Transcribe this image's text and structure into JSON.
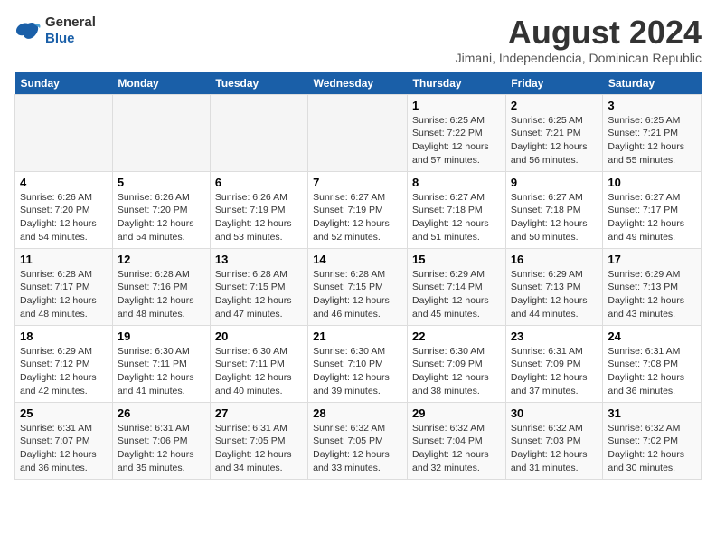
{
  "header": {
    "logo_general": "General",
    "logo_blue": "Blue",
    "month_year": "August 2024",
    "location": "Jimani, Independencia, Dominican Republic"
  },
  "calendar": {
    "weekdays": [
      "Sunday",
      "Monday",
      "Tuesday",
      "Wednesday",
      "Thursday",
      "Friday",
      "Saturday"
    ],
    "weeks": [
      [
        {
          "day": "",
          "info": ""
        },
        {
          "day": "",
          "info": ""
        },
        {
          "day": "",
          "info": ""
        },
        {
          "day": "",
          "info": ""
        },
        {
          "day": "1",
          "info": "Sunrise: 6:25 AM\nSunset: 7:22 PM\nDaylight: 12 hours and 57 minutes."
        },
        {
          "day": "2",
          "info": "Sunrise: 6:25 AM\nSunset: 7:21 PM\nDaylight: 12 hours and 56 minutes."
        },
        {
          "day": "3",
          "info": "Sunrise: 6:25 AM\nSunset: 7:21 PM\nDaylight: 12 hours and 55 minutes."
        }
      ],
      [
        {
          "day": "4",
          "info": "Sunrise: 6:26 AM\nSunset: 7:20 PM\nDaylight: 12 hours and 54 minutes."
        },
        {
          "day": "5",
          "info": "Sunrise: 6:26 AM\nSunset: 7:20 PM\nDaylight: 12 hours and 54 minutes."
        },
        {
          "day": "6",
          "info": "Sunrise: 6:26 AM\nSunset: 7:19 PM\nDaylight: 12 hours and 53 minutes."
        },
        {
          "day": "7",
          "info": "Sunrise: 6:27 AM\nSunset: 7:19 PM\nDaylight: 12 hours and 52 minutes."
        },
        {
          "day": "8",
          "info": "Sunrise: 6:27 AM\nSunset: 7:18 PM\nDaylight: 12 hours and 51 minutes."
        },
        {
          "day": "9",
          "info": "Sunrise: 6:27 AM\nSunset: 7:18 PM\nDaylight: 12 hours and 50 minutes."
        },
        {
          "day": "10",
          "info": "Sunrise: 6:27 AM\nSunset: 7:17 PM\nDaylight: 12 hours and 49 minutes."
        }
      ],
      [
        {
          "day": "11",
          "info": "Sunrise: 6:28 AM\nSunset: 7:17 PM\nDaylight: 12 hours and 48 minutes."
        },
        {
          "day": "12",
          "info": "Sunrise: 6:28 AM\nSunset: 7:16 PM\nDaylight: 12 hours and 48 minutes."
        },
        {
          "day": "13",
          "info": "Sunrise: 6:28 AM\nSunset: 7:15 PM\nDaylight: 12 hours and 47 minutes."
        },
        {
          "day": "14",
          "info": "Sunrise: 6:28 AM\nSunset: 7:15 PM\nDaylight: 12 hours and 46 minutes."
        },
        {
          "day": "15",
          "info": "Sunrise: 6:29 AM\nSunset: 7:14 PM\nDaylight: 12 hours and 45 minutes."
        },
        {
          "day": "16",
          "info": "Sunrise: 6:29 AM\nSunset: 7:13 PM\nDaylight: 12 hours and 44 minutes."
        },
        {
          "day": "17",
          "info": "Sunrise: 6:29 AM\nSunset: 7:13 PM\nDaylight: 12 hours and 43 minutes."
        }
      ],
      [
        {
          "day": "18",
          "info": "Sunrise: 6:29 AM\nSunset: 7:12 PM\nDaylight: 12 hours and 42 minutes."
        },
        {
          "day": "19",
          "info": "Sunrise: 6:30 AM\nSunset: 7:11 PM\nDaylight: 12 hours and 41 minutes."
        },
        {
          "day": "20",
          "info": "Sunrise: 6:30 AM\nSunset: 7:11 PM\nDaylight: 12 hours and 40 minutes."
        },
        {
          "day": "21",
          "info": "Sunrise: 6:30 AM\nSunset: 7:10 PM\nDaylight: 12 hours and 39 minutes."
        },
        {
          "day": "22",
          "info": "Sunrise: 6:30 AM\nSunset: 7:09 PM\nDaylight: 12 hours and 38 minutes."
        },
        {
          "day": "23",
          "info": "Sunrise: 6:31 AM\nSunset: 7:09 PM\nDaylight: 12 hours and 37 minutes."
        },
        {
          "day": "24",
          "info": "Sunrise: 6:31 AM\nSunset: 7:08 PM\nDaylight: 12 hours and 36 minutes."
        }
      ],
      [
        {
          "day": "25",
          "info": "Sunrise: 6:31 AM\nSunset: 7:07 PM\nDaylight: 12 hours and 36 minutes."
        },
        {
          "day": "26",
          "info": "Sunrise: 6:31 AM\nSunset: 7:06 PM\nDaylight: 12 hours and 35 minutes."
        },
        {
          "day": "27",
          "info": "Sunrise: 6:31 AM\nSunset: 7:05 PM\nDaylight: 12 hours and 34 minutes."
        },
        {
          "day": "28",
          "info": "Sunrise: 6:32 AM\nSunset: 7:05 PM\nDaylight: 12 hours and 33 minutes."
        },
        {
          "day": "29",
          "info": "Sunrise: 6:32 AM\nSunset: 7:04 PM\nDaylight: 12 hours and 32 minutes."
        },
        {
          "day": "30",
          "info": "Sunrise: 6:32 AM\nSunset: 7:03 PM\nDaylight: 12 hours and 31 minutes."
        },
        {
          "day": "31",
          "info": "Sunrise: 6:32 AM\nSunset: 7:02 PM\nDaylight: 12 hours and 30 minutes."
        }
      ]
    ]
  }
}
